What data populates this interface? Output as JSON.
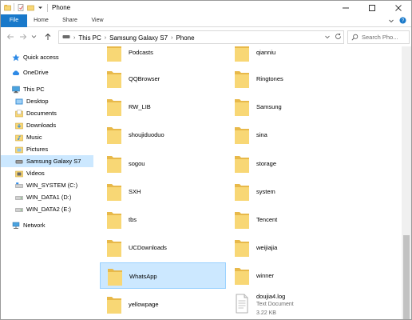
{
  "window": {
    "title": "Phone"
  },
  "ribbon": {
    "tabs": [
      "File",
      "Home",
      "Share",
      "View"
    ]
  },
  "address": {
    "crumbs": [
      "This PC",
      "Samsung Galaxy S7",
      "Phone"
    ],
    "search_placeholder": "Search Pho..."
  },
  "nav": {
    "items": [
      {
        "label": "Quick access",
        "icon": "star-icon"
      },
      {
        "label": "OneDrive",
        "icon": "cloud-icon"
      },
      {
        "label": "This PC",
        "icon": "computer-icon"
      },
      {
        "label": "Desktop",
        "icon": "desktop-folder-icon"
      },
      {
        "label": "Documents",
        "icon": "documents-folder-icon"
      },
      {
        "label": "Downloads",
        "icon": "downloads-folder-icon"
      },
      {
        "label": "Music",
        "icon": "music-folder-icon"
      },
      {
        "label": "Pictures",
        "icon": "pictures-folder-icon"
      },
      {
        "label": "Samsung Galaxy S7",
        "icon": "phone-icon"
      },
      {
        "label": "Videos",
        "icon": "videos-folder-icon"
      },
      {
        "label": "WIN_SYSTEM (C:)",
        "icon": "drive-icon"
      },
      {
        "label": "WIN_DATA1 (D:)",
        "icon": "drive-icon"
      },
      {
        "label": "WIN_DATA2 (E:)",
        "icon": "drive-icon"
      },
      {
        "label": "Network",
        "icon": "network-icon"
      }
    ],
    "selected": "Samsung Galaxy S7"
  },
  "items": [
    {
      "name": "Podcasts",
      "type": "folder"
    },
    {
      "name": "qianniu",
      "type": "folder"
    },
    {
      "name": "QQBrowser",
      "type": "folder"
    },
    {
      "name": "Ringtones",
      "type": "folder"
    },
    {
      "name": "RW_LIB",
      "type": "folder"
    },
    {
      "name": "Samsung",
      "type": "folder"
    },
    {
      "name": "shoujiduoduo",
      "type": "folder"
    },
    {
      "name": "sina",
      "type": "folder"
    },
    {
      "name": "sogou",
      "type": "folder"
    },
    {
      "name": "storage",
      "type": "folder"
    },
    {
      "name": "SXH",
      "type": "folder"
    },
    {
      "name": "system",
      "type": "folder"
    },
    {
      "name": "tbs",
      "type": "folder"
    },
    {
      "name": "Tencent",
      "type": "folder"
    },
    {
      "name": "UCDownloads",
      "type": "folder"
    },
    {
      "name": "weijiajia",
      "type": "folder"
    },
    {
      "name": "WhatsApp",
      "type": "folder",
      "selected": true
    },
    {
      "name": "winner",
      "type": "folder"
    },
    {
      "name": "yellowpage",
      "type": "folder"
    },
    {
      "name": "doujia4.log",
      "type": "file",
      "kind": "Text Document",
      "size": "3.22 KB"
    }
  ],
  "colors": {
    "file_tab": "#1979ca",
    "selection": "#cce8ff",
    "selection_border": "#99d1ff",
    "folder": "#f8d775"
  }
}
